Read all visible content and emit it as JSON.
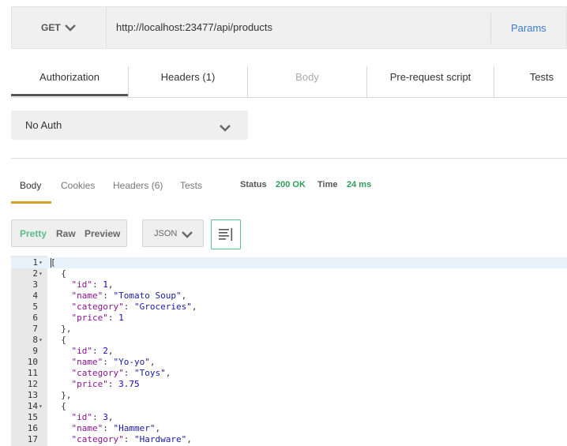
{
  "request": {
    "method": "GET",
    "url": "http://localhost:23477/api/products",
    "params_label": "Params"
  },
  "request_tabs": [
    {
      "label": "Authorization",
      "state": "active"
    },
    {
      "label": "Headers (1)",
      "state": "normal"
    },
    {
      "label": "Body",
      "state": "disabled"
    },
    {
      "label": "Pre-request script",
      "state": "normal"
    },
    {
      "label": "Tests",
      "state": "normal"
    }
  ],
  "auth": {
    "selected": "No Auth"
  },
  "response_tabs": [
    {
      "label": "Body",
      "state": "active"
    },
    {
      "label": "Cookies",
      "state": "normal"
    },
    {
      "label": "Headers (6)",
      "state": "normal"
    },
    {
      "label": "Tests",
      "state": "normal"
    }
  ],
  "response_meta": {
    "status_label": "Status",
    "status_value": "200 OK",
    "time_label": "Time",
    "time_value": "24 ms"
  },
  "view_modes": [
    "Pretty",
    "Raw",
    "Preview"
  ],
  "active_view": "Pretty",
  "format": "JSON",
  "colors": {
    "accent_green": "#5bbd8a",
    "status_green": "#2e9b5a",
    "tab_underline": "#d3a32a",
    "link_blue": "#3a7bc8"
  },
  "code_lines": [
    {
      "n": "1",
      "fold": true,
      "text": "["
    },
    {
      "n": "2",
      "fold": true,
      "text": "  {"
    },
    {
      "n": "3",
      "fold": false,
      "text": "    \"id\": 1,"
    },
    {
      "n": "4",
      "fold": false,
      "text": "    \"name\": \"Tomato Soup\","
    },
    {
      "n": "5",
      "fold": false,
      "text": "    \"category\": \"Groceries\","
    },
    {
      "n": "6",
      "fold": false,
      "text": "    \"price\": 1"
    },
    {
      "n": "7",
      "fold": false,
      "text": "  },"
    },
    {
      "n": "8",
      "fold": true,
      "text": "  {"
    },
    {
      "n": "9",
      "fold": false,
      "text": "    \"id\": 2,"
    },
    {
      "n": "10",
      "fold": false,
      "text": "    \"name\": \"Yo-yo\","
    },
    {
      "n": "11",
      "fold": false,
      "text": "    \"category\": \"Toys\","
    },
    {
      "n": "12",
      "fold": false,
      "text": "    \"price\": 3.75"
    },
    {
      "n": "13",
      "fold": false,
      "text": "  },"
    },
    {
      "n": "14",
      "fold": true,
      "text": "  {"
    },
    {
      "n": "15",
      "fold": false,
      "text": "    \"id\": 3,"
    },
    {
      "n": "16",
      "fold": false,
      "text": "    \"name\": \"Hammer\","
    },
    {
      "n": "17",
      "fold": false,
      "text": "    \"category\": \"Hardware\","
    }
  ]
}
